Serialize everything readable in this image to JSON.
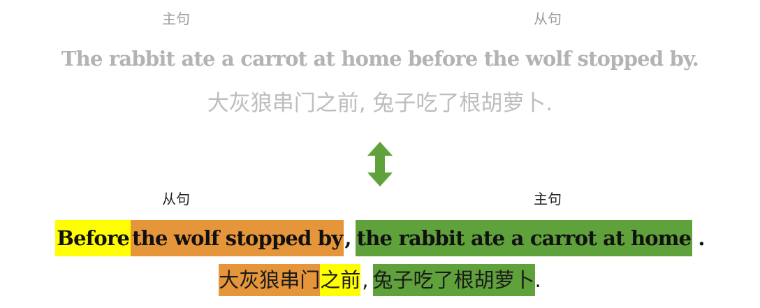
{
  "top": {
    "label_left": "主句",
    "label_right": "从句",
    "english": "The rabbit ate a carrot at home before the wolf stopped by.",
    "chinese": "大灰狼串门之前, 兔子吃了根胡萝卜."
  },
  "bottom": {
    "label_left": "从句",
    "label_right": "主句",
    "english": {
      "before": "Before",
      "clause": "the wolf stopped by",
      "comma": ",",
      "main": "the rabbit ate a carrot at home",
      "period": "."
    },
    "chinese": {
      "clause": "大灰狼串门",
      "before": "之前",
      "comma": ",",
      "main": "兔子吃了根胡萝卜",
      "period": "."
    }
  },
  "colors": {
    "highlight_before": "#ffff00",
    "highlight_clause": "#e6963a",
    "highlight_main": "#5fa13a",
    "arrow": "#5fa13a",
    "faded_text": "#b3b3b3"
  },
  "icons": {
    "arrow": "double-vertical-arrow"
  }
}
